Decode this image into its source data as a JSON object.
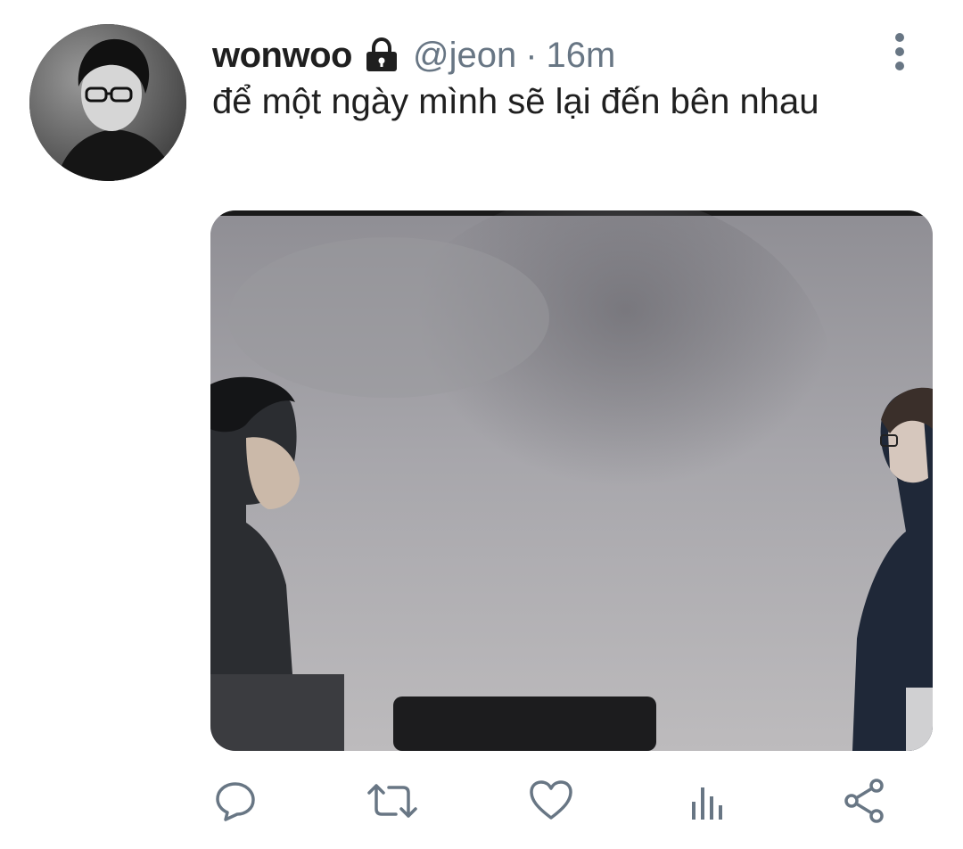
{
  "tweet": {
    "display_name": "wonwoo",
    "handle": "@jeon",
    "separator": "·",
    "time": "16m",
    "text": "để một ngày mình sẽ lại đến bên nhau",
    "protected": true
  },
  "icons": {
    "lock": "lock-icon",
    "more": "more-vertical-icon",
    "reply": "reply-icon",
    "retweet": "retweet-icon",
    "like": "heart-icon",
    "analytics": "analytics-icon",
    "share": "share-icon"
  },
  "colors": {
    "text_primary": "#1f1f1f",
    "text_secondary": "#687684",
    "icon": "#687684"
  }
}
